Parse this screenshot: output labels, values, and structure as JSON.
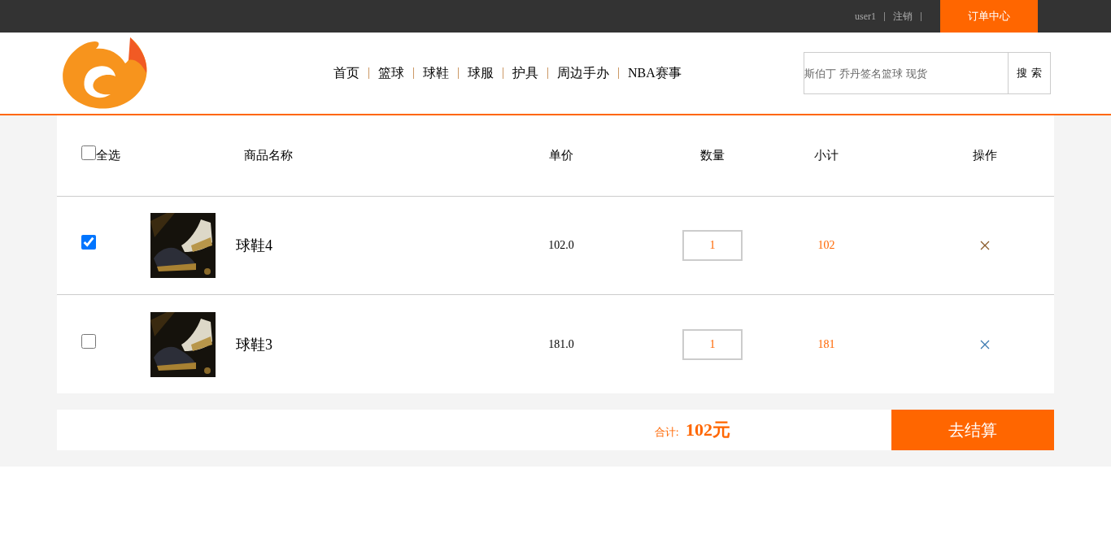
{
  "top_bar": {
    "user": "user1",
    "logout": "注销",
    "order_center": "订单中心"
  },
  "nav": [
    "首页",
    "篮球",
    "球鞋",
    "球服",
    "护具",
    "周边手办",
    "NBA赛事"
  ],
  "search": {
    "placeholder": "斯伯丁 乔丹签名篮球 现货",
    "button": "搜 索"
  },
  "table": {
    "select_all": {
      "label": "全选",
      "checked": false
    },
    "columns": [
      "商品名称",
      "单价",
      "数量",
      "小计",
      "操作"
    ],
    "rows": [
      {
        "checked": true,
        "name": "球鞋4",
        "price": "102.0",
        "quantity": "1",
        "subtotal": "102"
      },
      {
        "checked": false,
        "name": "球鞋3",
        "price": "181.0",
        "quantity": "1",
        "subtotal": "181"
      }
    ]
  },
  "footer": {
    "total_label": "合计:",
    "total": "102元",
    "checkout": "去结算"
  }
}
